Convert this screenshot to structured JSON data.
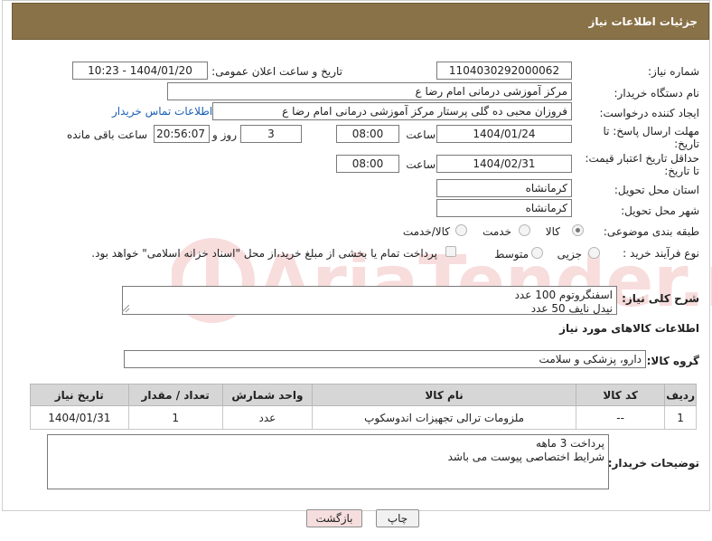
{
  "header": {
    "title": "جزئیات اطلاعات نیاز"
  },
  "form": {
    "need_number_label": "شماره نیاز:",
    "need_number": "1104030292000062",
    "announce_label": "تاریخ و ساعت اعلان عمومی:",
    "announce_value": "1404/01/20 - 10:23",
    "buyer_org_label": "نام دستگاه خریدار:",
    "buyer_org": "مرکز آموزشی  درمانی امام رضا  ع",
    "creator_label": "ایجاد کننده درخواست:",
    "creator": "فروزان محبی ده گلی پرستار مرکز آموزشی  درمانی امام رضا  ع",
    "contact_link": "اطلاعات تماس خریدار",
    "deadline_label_1": "مهلت ارسال پاسخ: تا",
    "deadline_label_2": "تاریخ:",
    "deadline_date": "1404/01/24",
    "time_label": "ساعت",
    "deadline_time": "08:00",
    "days_value": "3",
    "days_label": "روز و",
    "remaining_time": "20:56:07",
    "remaining_label": "ساعت باقی مانده",
    "validity_label_1": "حداقل تاریخ اعتبار قیمت:",
    "validity_label_2": "تا تاریخ:",
    "validity_date": "1404/02/31",
    "validity_time_label": "ساعت",
    "validity_time": "08:00",
    "province_label": "استان محل تحویل:",
    "province": "کرمانشاه",
    "city_label": "شهر محل تحویل:",
    "city": "کرمانشاه",
    "category_label": "طبقه بندی موضوعی:",
    "category_options": [
      "کالا",
      "خدمت",
      "کالا/خدمت"
    ],
    "purchase_type_label": "نوع فرآیند خرید :",
    "purchase_options": [
      "جزیی",
      "متوسط"
    ],
    "payment_note": "پرداخت تمام یا بخشی از مبلغ خرید،از محل \"اسناد خزانه اسلامی\" خواهد بود."
  },
  "description": {
    "label": "شرح کلی نیاز:",
    "text": "اسفنگروتوم   100 عدد\nنیدل نایف    50 عدد"
  },
  "goods": {
    "section_title": "اطلاعات کالاهای مورد نیاز",
    "group_label": "گروه کالا:",
    "group_value": "دارو، پزشکی و سلامت",
    "columns": [
      "ردیف",
      "کد کالا",
      "نام کالا",
      "واحد شمارش",
      "تعداد / مقدار",
      "تاریخ نیاز"
    ],
    "rows": [
      [
        "1",
        "--",
        "ملزومات ترالی تجهیزات اندوسکوپ",
        "عدد",
        "1",
        "1404/01/31"
      ]
    ]
  },
  "buyer_notes": {
    "label": "توضیحات خریدار:",
    "text": "پرداخت 3 ماهه\nشرایط اختصاصی پیوست می باشد"
  },
  "buttons": {
    "print": "چاپ",
    "back": "بازگشت"
  },
  "watermark": "AriaTender.net",
  "colors": {
    "header_bg": "#8a7248",
    "link": "#1a5fb4",
    "back_button_bg": "#f6dede"
  }
}
